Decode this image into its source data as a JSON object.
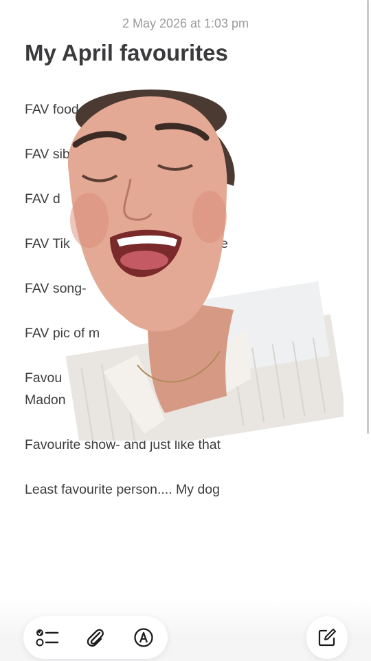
{
  "note": {
    "timestamp": "2 May 2026 at 1:03 pm",
    "title": "My April favourites",
    "lines": [
      "FAV food- c",
      "FAV sib",
      "FAV d",
      "FAV Tik",
      "FAV song-",
      "FAV pic of m",
      "Favou",
      "Madon",
      "Favourite show- and just like that",
      "Least favourite person.... My dog"
    ],
    "line_fragments_right": {
      "tiktok_tail": "e"
    }
  },
  "toolbar": {
    "checklist_icon": "checklist-icon",
    "attachment_icon": "paperclip-icon",
    "markup_icon": "markup-pen-icon",
    "compose_icon": "compose-icon"
  },
  "overlay": {
    "description_icon": "person-face-sticker"
  }
}
